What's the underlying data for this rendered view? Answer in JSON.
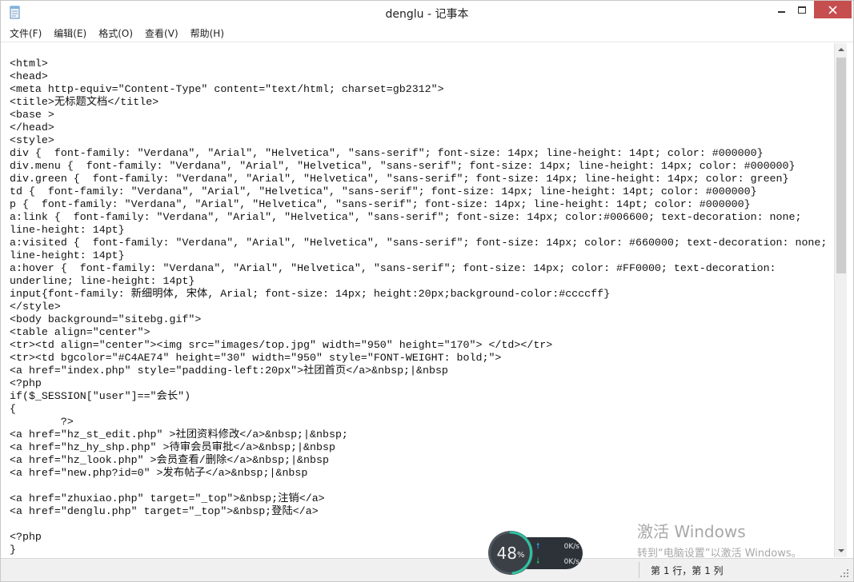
{
  "window": {
    "title": "denglu - 记事本"
  },
  "menu": [
    {
      "label": "文件(F)"
    },
    {
      "label": "编辑(E)"
    },
    {
      "label": "格式(O)"
    },
    {
      "label": "查看(V)"
    },
    {
      "label": "帮助(H)"
    }
  ],
  "editor": {
    "lines": [
      "<html>",
      "<head>",
      "<meta http-equiv=\"Content-Type\" content=\"text/html; charset=gb2312\">",
      "<title>无标题文档</title>",
      "<base >",
      "</head>",
      "<style>",
      "div {  font-family: \"Verdana\", \"Arial\", \"Helvetica\", \"sans-serif\"; font-size: 14px; line-height: 14pt; color: #000000}",
      "div.menu {  font-family: \"Verdana\", \"Arial\", \"Helvetica\", \"sans-serif\"; font-size: 14px; line-height: 14px; color: #000000}",
      "div.green {  font-family: \"Verdana\", \"Arial\", \"Helvetica\", \"sans-serif\"; font-size: 14px; line-height: 14px; color: green}",
      "td {  font-family: \"Verdana\", \"Arial\", \"Helvetica\", \"sans-serif\"; font-size: 14px; line-height: 14pt; color: #000000}",
      "p {  font-family: \"Verdana\", \"Arial\", \"Helvetica\", \"sans-serif\"; font-size: 14px; line-height: 14pt; color: #000000}",
      "a:link {  font-family: \"Verdana\", \"Arial\", \"Helvetica\", \"sans-serif\"; font-size: 14px; color:#006600; text-decoration: none;",
      "line-height: 14pt}",
      "a:visited {  font-family: \"Verdana\", \"Arial\", \"Helvetica\", \"sans-serif\"; font-size: 14px; color: #660000; text-decoration: none;",
      "line-height: 14pt}",
      "a:hover {  font-family: \"Verdana\", \"Arial\", \"Helvetica\", \"sans-serif\"; font-size: 14px; color: #FF0000; text-decoration:",
      "underline; line-height: 14pt}",
      "input{font-family: 新细明体, 宋体, Arial; font-size: 14px; height:20px;background-color:#ccccff}",
      "</style>",
      "<body background=\"sitebg.gif\">",
      "<table align=\"center\">",
      "<tr><td align=\"center\"><img src=\"images/top.jpg\" width=\"950\" height=\"170\"> </td></tr>",
      "<tr><td bgcolor=\"#C4AE74\" height=\"30\" width=\"950\" style=\"FONT-WEIGHT: bold;\">",
      "<a href=\"index.php\" style=\"padding-left:20px\">社团首页</a>&nbsp;|&nbsp",
      "<?php",
      "if($_SESSION[\"user\"]==\"会长\")",
      "{",
      "        ?>",
      "<a href=\"hz_st_edit.php\" >社团资料修改</a>&nbsp;|&nbsp;",
      "<a href=\"hz_hy_shp.php\" >待审会员审批</a>&nbsp;|&nbsp",
      "<a href=\"hz_look.php\" >会员查看/删除</a>&nbsp;|&nbsp",
      "<a href=\"new.php?id=0\" >发布帖子</a>&nbsp;|&nbsp",
      "",
      "<a href=\"zhuxiao.php\" target=\"_top\">&nbsp;注销</a>",
      "<a href=\"denglu.php\" target=\"_top\">&nbsp;登陆</a>",
      "",
      "<?php",
      "}"
    ]
  },
  "status": {
    "position": "第 1 行，第 1 列"
  },
  "watermark": {
    "title": "激活 Windows",
    "subtitle": "转到“电脑设置”以激活 Windows。"
  },
  "speed_widget": {
    "percent": "48",
    "percent_sign": "%",
    "upload": "0K/s",
    "download": "0K/s",
    "ring_fraction": 0.48,
    "ring_color": "#2ec4a0"
  },
  "colors": {
    "close_button": "#c74e4e",
    "upload_arrow": "#2ea8ff",
    "download_arrow": "#27c26a"
  }
}
